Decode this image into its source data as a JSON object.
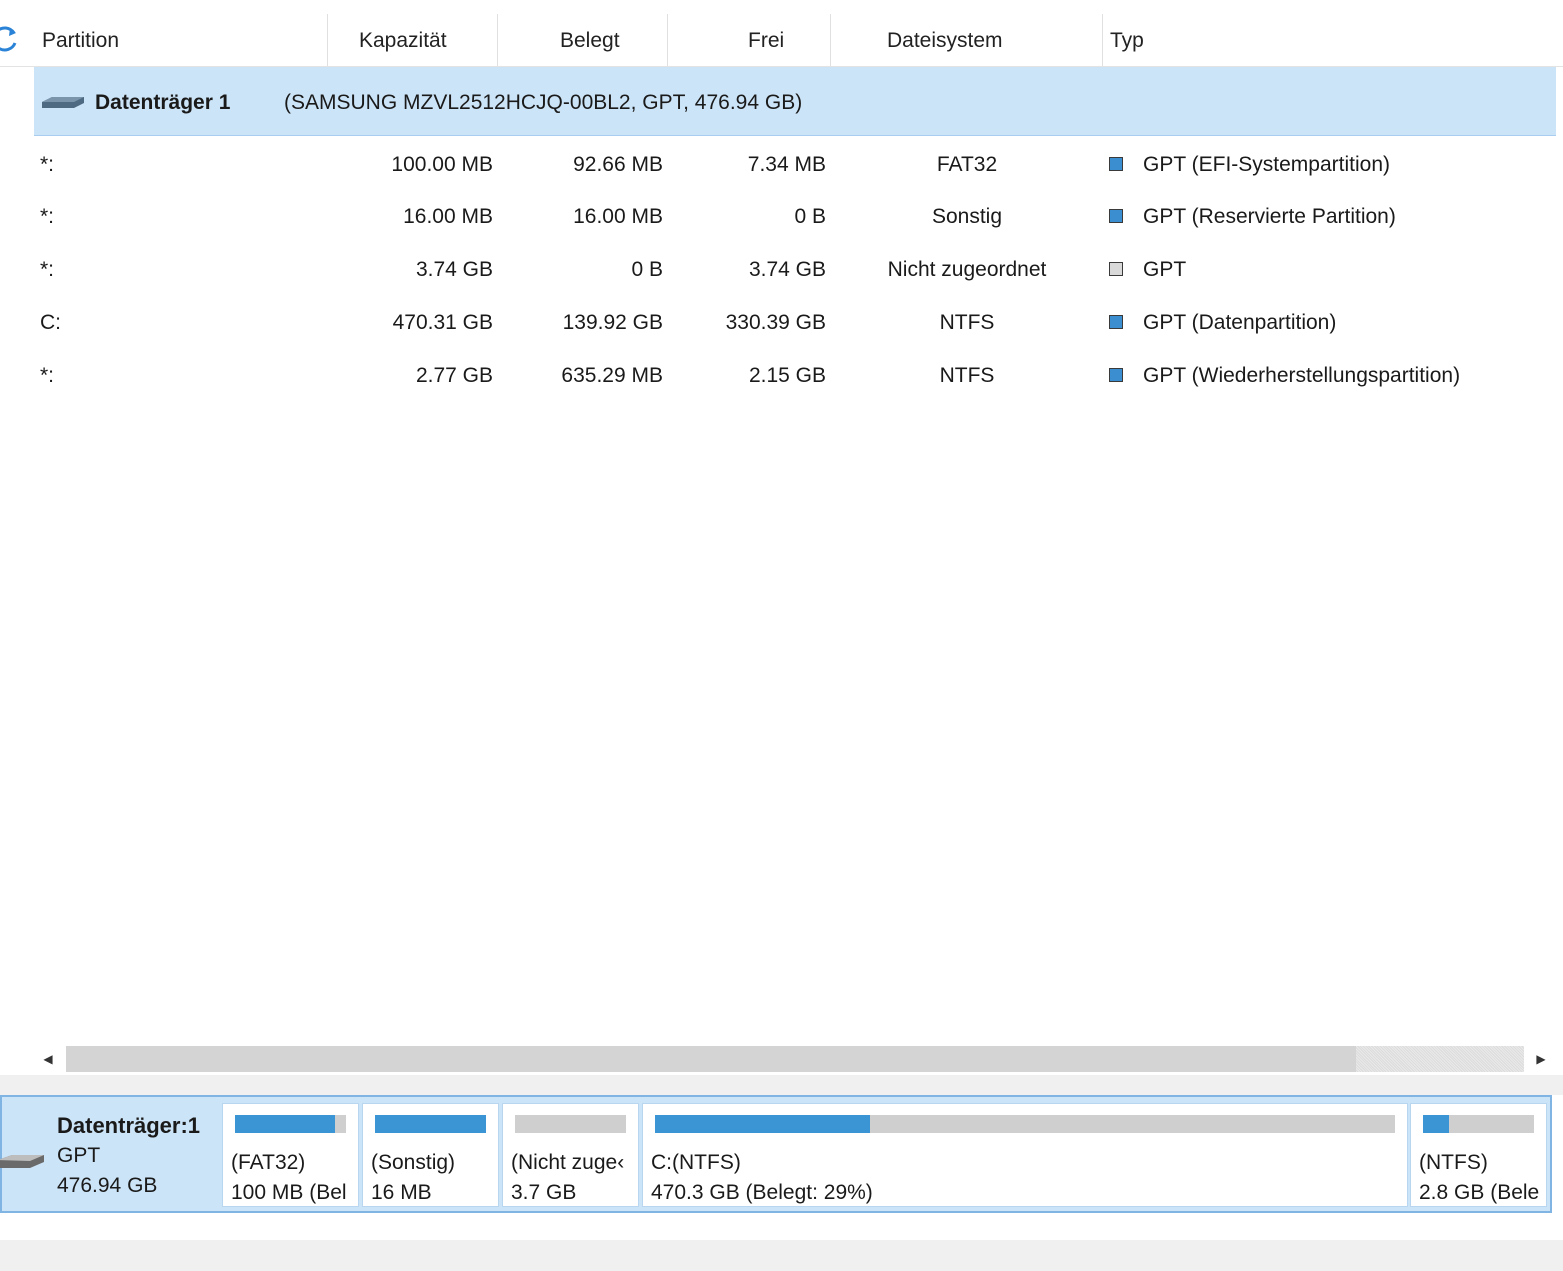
{
  "header": {
    "columns": [
      "Partition",
      "Kapazität",
      "Belegt",
      "Frei",
      "Dateisystem",
      "Typ"
    ]
  },
  "disk": {
    "name": "Datenträger 1",
    "detail": "(SAMSUNG MZVL2512HCJQ-00BL2, GPT, 476.94 GB)"
  },
  "partitions": [
    {
      "partition": "*:",
      "capacity": "100.00 MB",
      "used": "92.66 MB",
      "free": "7.34 MB",
      "fs": "FAT32",
      "type": "GPT (EFI-Systempartition)",
      "color": "#3b8fd0"
    },
    {
      "partition": "*:",
      "capacity": "16.00 MB",
      "used": "16.00 MB",
      "free": "0 B",
      "fs": "Sonstig",
      "type": "GPT (Reservierte Partition)",
      "color": "#3b8fd0"
    },
    {
      "partition": "*:",
      "capacity": "3.74 GB",
      "used": "0 B",
      "free": "3.74 GB",
      "fs": "Nicht zugeordnet",
      "type": "GPT",
      "color": "#d9d9d9"
    },
    {
      "partition": "C:",
      "capacity": "470.31 GB",
      "used": "139.92 GB",
      "free": "330.39 GB",
      "fs": "NTFS",
      "type": "GPT (Datenpartition)",
      "color": "#3b8fd0"
    },
    {
      "partition": "*:",
      "capacity": "2.77 GB",
      "used": "635.29 MB",
      "free": "2.15 GB",
      "fs": "NTFS",
      "type": "GPT (Wiederherstellungspartition)",
      "color": "#3b8fd0"
    }
  ],
  "scrollbar": {
    "left_arrow": "◀",
    "right_arrow": "▶"
  },
  "diskmap": {
    "title": "Datenträger:1",
    "scheme": "GPT",
    "size": "476.94 GB",
    "blocks": [
      {
        "line1": "(FAT32)",
        "line2": "100 MB (Bel",
        "used_fraction": 0.9
      },
      {
        "line1": "(Sonstig)",
        "line2": "16 MB",
        "used_fraction": 1.0
      },
      {
        "line1": "(Nicht zuge‹",
        "line2": "3.7 GB",
        "used_fraction": 0.0
      },
      {
        "line1": "C:(NTFS)",
        "line2": "470.3 GB (Belegt: 29%)",
        "used_fraction": 0.29
      },
      {
        "line1": "(NTFS)",
        "line2": "2.8 GB (Bele",
        "used_fraction": 0.23
      }
    ]
  },
  "colors": {
    "accent": "#3b94d3",
    "selection": "#cce4f7",
    "unallocated": "#cfcfcf"
  },
  "icons": [
    "refresh-icon",
    "disk-icon"
  ]
}
